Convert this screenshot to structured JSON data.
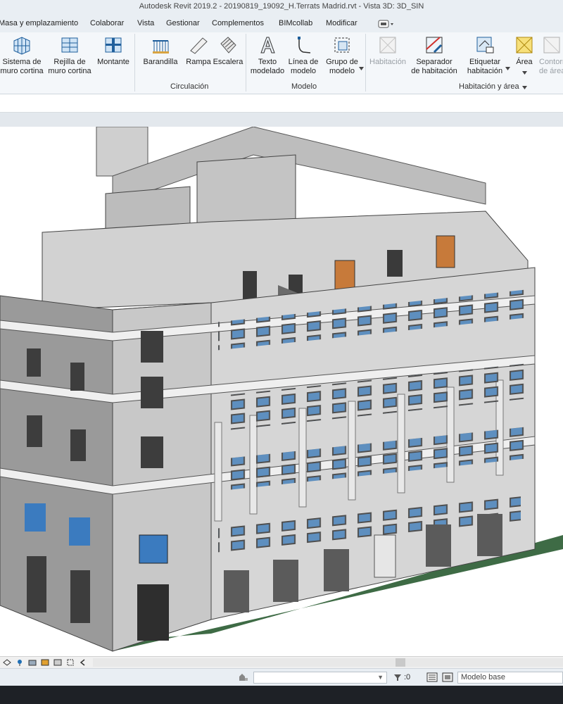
{
  "window": {
    "title": "Autodesk Revit 2019.2 - 20190819_19092_H.Terrats Madrid.rvt - Vista 3D: 3D_SIN"
  },
  "menu": {
    "items": [
      "Masa y emplazamiento",
      "Colaborar",
      "Vista",
      "Gestionar",
      "Complementos",
      "BIMcollab",
      "Modificar"
    ]
  },
  "ribbon": {
    "buttons": [
      {
        "line1": "Sistema de",
        "line2": "muro cortina",
        "icon": "curtain-system-icon"
      },
      {
        "line1": "Rejilla de",
        "line2": "muro cortina",
        "icon": "curtain-grid-icon"
      },
      {
        "line1": "Montante",
        "line2": "",
        "icon": "mullion-icon"
      },
      {
        "line1": "Barandilla",
        "line2": "",
        "icon": "railing-icon"
      },
      {
        "line1": "Rampa",
        "line2": "",
        "icon": "ramp-icon"
      },
      {
        "line1": "Escalera",
        "line2": "",
        "icon": "stair-icon"
      },
      {
        "line1": "Texto",
        "line2": "modelado",
        "icon": "model-text-icon"
      },
      {
        "line1": "Línea de",
        "line2": "modelo",
        "icon": "model-line-icon"
      },
      {
        "line1": "Grupo de",
        "line2": "modelo",
        "icon": "model-group-icon"
      },
      {
        "line1": "Habitación",
        "line2": "",
        "icon": "room-icon"
      },
      {
        "line1": "Separador",
        "line2": "de habitación",
        "icon": "room-separator-icon"
      },
      {
        "line1": "Etiquetar",
        "line2": "habitación",
        "icon": "tag-room-icon"
      },
      {
        "line1": "Área",
        "line2": "",
        "icon": "area-icon"
      },
      {
        "line1": "Contorno",
        "line2": "de área",
        "icon": "area-boundary-icon"
      }
    ],
    "groups": [
      "Circulación",
      "Modelo",
      "Habitación y área"
    ]
  },
  "status": {
    "selection_count": ":0",
    "model": "Modelo base"
  },
  "colors": {
    "ribbon_bg": "#f4f7fa",
    "chrome_bg": "#e9eef3",
    "accent_blue": "#1f6fb5",
    "facade_light": "#d9d9d9",
    "facade_dark": "#8c8c8c",
    "ground_green": "#4a7a52",
    "window_blue": "#3b7bbf",
    "door_orange": "#c77a3a"
  }
}
